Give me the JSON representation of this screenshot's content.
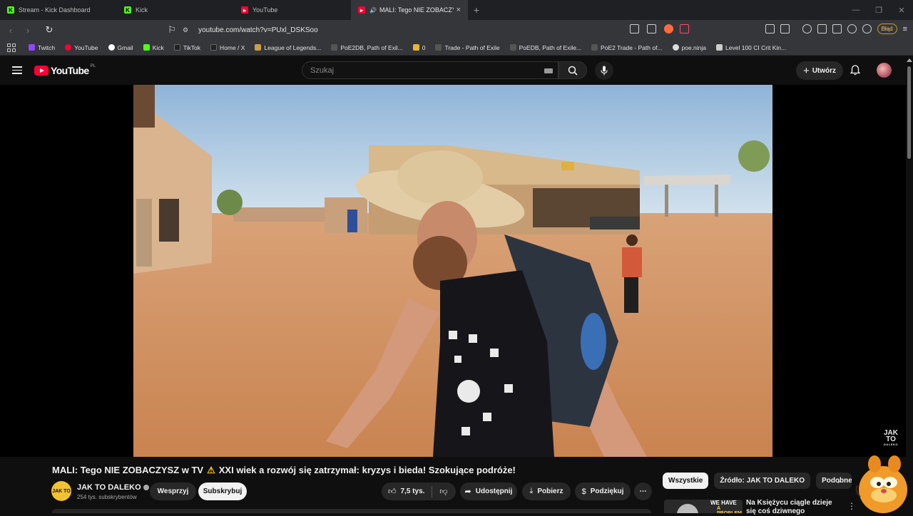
{
  "browser": {
    "tabs": [
      {
        "label": "Stream - Kick Dashboard",
        "icon": "kick-icon",
        "active": false
      },
      {
        "label": "Kick",
        "icon": "kick-icon",
        "active": false
      },
      {
        "label": "YouTube",
        "icon": "youtube-icon",
        "active": false
      },
      {
        "label": "MALI: Tego NIE ZOBACZYSZ",
        "icon": "youtube-icon",
        "active": true
      }
    ],
    "url": "youtube.com/watch?v=PUxl_DSKSoo",
    "error_label": "Błąd",
    "bookmarks": [
      {
        "label": "Twitch",
        "color": "#9146ff"
      },
      {
        "label": "YouTube",
        "color": "#ff0033"
      },
      {
        "label": "Gmail",
        "color": "#ffffff"
      },
      {
        "label": "Kick",
        "color": "#53fc18"
      },
      {
        "label": "TikTok",
        "color": "#111111"
      },
      {
        "label": "Home / X",
        "color": "#111111"
      },
      {
        "label": "League of Legends...",
        "color": "#c8a04a"
      },
      {
        "label": "PoE2DB, Path of Exil...",
        "color": "#555555"
      },
      {
        "label": "0",
        "color": "#e8b53a"
      },
      {
        "label": "Trade - Path of Exile",
        "color": "#555555"
      },
      {
        "label": "PoEDB, Path of Exile...",
        "color": "#555555"
      },
      {
        "label": "PoE2 Trade - Path of...",
        "color": "#555555"
      },
      {
        "label": "poe.ninja",
        "color": "#dddddd"
      },
      {
        "label": "Level 100 CI Crit Kin...",
        "color": "#cccccc"
      }
    ]
  },
  "youtube": {
    "logo_text": "YouTube",
    "region": "PL",
    "search_placeholder": "Szukaj",
    "create_label": "Utwórz",
    "watermark_line1": "JAK",
    "watermark_line2": "TO",
    "watermark_line3": "DALEKO"
  },
  "video": {
    "title_part1": "MALI: Tego NIE ZOBACZYSZ w TV",
    "title_part2": "XXI wiek a rozwój się zatrzymał: kryzys i bieda! Szokujące podróże!",
    "channel_name": "JAK TO DALEKO",
    "channel_avatar_text": "JAK TO",
    "subscribers": "254 tys. subskrybentów",
    "support_label": "Wesprzyj",
    "subscribe_label": "Subskrybuj",
    "likes": "7,5 tys.",
    "share_label": "Udostępnij",
    "download_label": "Pobierz",
    "thanks_label": "Podziękuj"
  },
  "sidebar": {
    "chips": [
      {
        "label": "Wszystkie",
        "active": true
      },
      {
        "label": "Źródło: JAK TO DALEKO",
        "active": false
      },
      {
        "label": "Podobne",
        "active": false
      }
    ],
    "recommendation": {
      "thumb_line1": "WE HAVE",
      "thumb_line2": "A PROBLEM",
      "title": "Na Księżycu ciągle dzieje się coś dziwnego"
    }
  }
}
